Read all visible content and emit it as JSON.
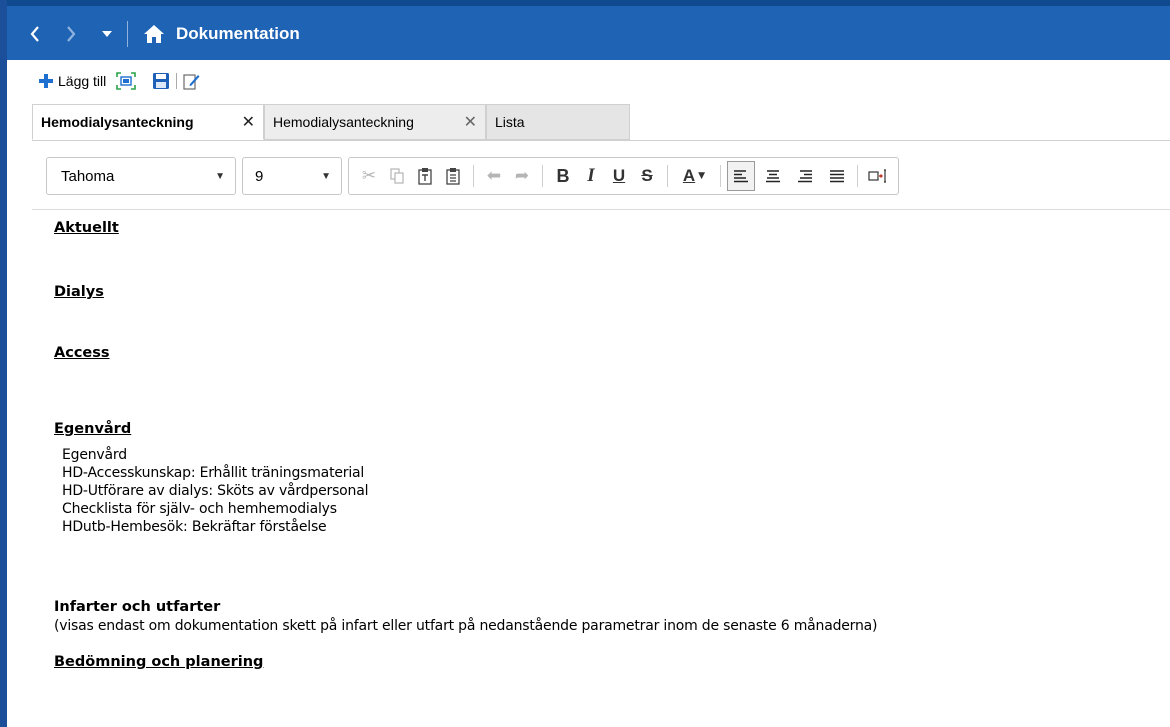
{
  "header": {
    "title": "Dokumentation",
    "back_icon": "chevron-left-icon",
    "forward_icon": "chevron-right-icon",
    "dropdown_icon": "caret-down-icon",
    "home_icon": "home-icon"
  },
  "actions": {
    "add_label": "Lägg till",
    "add_icon": "plus-icon",
    "preview_icon": "fit-screen-icon",
    "save_icon": "save-icon",
    "edit_icon": "edit-document-icon"
  },
  "tabs": [
    {
      "label": "Hemodialysanteckning",
      "active": true
    },
    {
      "label": "Hemodialysanteckning",
      "active": false
    },
    {
      "label": "Lista",
      "active": false
    }
  ],
  "format_toolbar": {
    "font": "Tahoma",
    "size": "9"
  },
  "document": {
    "sections": {
      "aktuellt": "Aktuellt",
      "dialys": "Dialys",
      "access": "Access",
      "egenvard": "Egenvård",
      "infarter": "Infarter och utfarter",
      "bedomning": "Bedömning och planering"
    },
    "egenvard_lines": [
      "Egenvård",
      "HD-Accesskunskap: Erhållit träningsmaterial",
      "HD-Utförare av dialys: Sköts av vårdpersonal",
      "Checklista för själv- och hemhemodialys",
      "HDutb-Hembesök: Bekräftar förståelse"
    ],
    "infarter_note": "(visas endast om dokumentation skett på infart eller utfart på nedanstående parametrar inom de senaste 6 månaderna)"
  },
  "colors": {
    "titlebar": "#1e63b4",
    "accent_strip": "#1b4f9a"
  }
}
